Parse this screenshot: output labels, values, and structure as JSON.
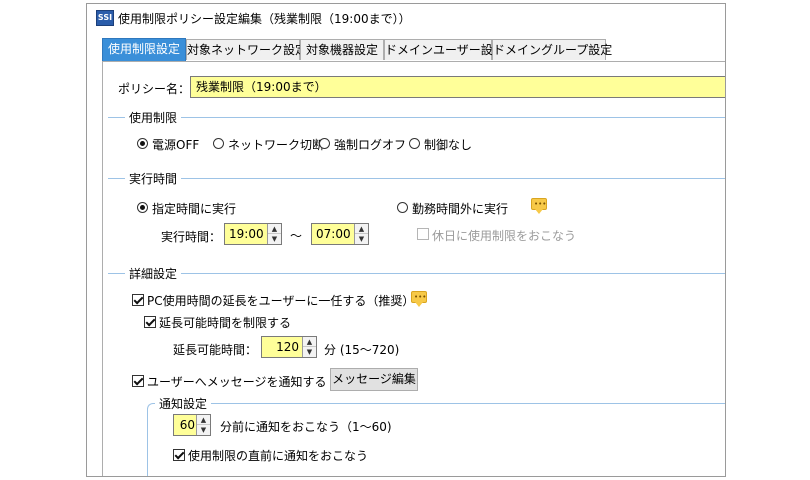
{
  "window": {
    "app_icon_text": "SSI",
    "title": "使用制限ポリシー設定編集（残業制限（19:00まで））"
  },
  "tabs": [
    {
      "label": "使用制限設定",
      "active": true
    },
    {
      "label": "対象ネットワーク設定",
      "active": false
    },
    {
      "label": "対象機器設定",
      "active": false
    },
    {
      "label": "ドメインユーザー設定",
      "active": false
    },
    {
      "label": "ドメイングループ設定",
      "active": false
    }
  ],
  "policy": {
    "label": "ポリシー名：",
    "value": "残業制限（19:00まで）"
  },
  "restriction": {
    "group_title": "使用制限",
    "options": [
      {
        "label": "電源OFF",
        "selected": true
      },
      {
        "label": "ネットワーク切断",
        "selected": false
      },
      {
        "label": "強制ログオフ",
        "selected": false
      },
      {
        "label": "制御なし",
        "selected": false
      }
    ]
  },
  "exec_time": {
    "group_title": "実行時間",
    "specified_label": "指定時間に実行",
    "outside_label": "勤務時間外に実行",
    "time_label": "実行時間：",
    "start": "19:00",
    "tilde": "～",
    "end": "07:00",
    "holiday_label": "休日に使用制限をおこなう"
  },
  "detail": {
    "group_title": "詳細設定",
    "delegate_label": "PC使用時間の延長をユーザーに一任する（推奨）",
    "limit_extension_label": "延長可能時間を制限する",
    "extension_time_label": "延長可能時間：",
    "extension_value": "120",
    "extension_unit": "分 (15～720)",
    "notify_label": "ユーザーへメッセージを通知する",
    "message_button": "メッセージ編集",
    "notify_group_title": "通知設定",
    "notify_minutes": "60",
    "notify_minutes_unit": "分前に通知をおこなう（1～60)",
    "notify_before_label": "使用制限の直前に通知をおこなう"
  },
  "colors": {
    "active_tab": "#3a8fd9",
    "input_bg": "#ffff99",
    "group_line": "#9dc3e6",
    "speech_icon": "#f7c948"
  }
}
